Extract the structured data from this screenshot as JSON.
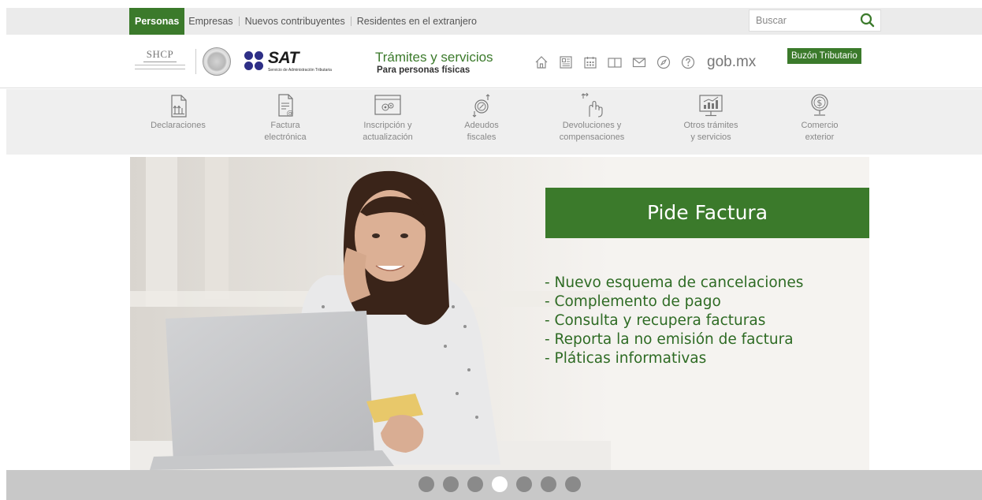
{
  "topbar": {
    "tabs": [
      {
        "label": "Personas",
        "active": true
      },
      {
        "label": "Empresas",
        "active": false
      },
      {
        "label": "Nuevos contribuyentes",
        "active": false
      },
      {
        "label": "Residentes en el extranjero",
        "active": false
      }
    ],
    "search": {
      "placeholder": "Buscar",
      "icon": "search-icon"
    }
  },
  "header": {
    "shcp_label": "SHCP",
    "sat_logo": "SAT",
    "sat_subtitle": "Servicio de Administración Tributaria",
    "tramites_title": "Trámites y servicios",
    "tramites_subtitle": "Para personas físicas",
    "nav_icons": [
      "home-icon",
      "news-icon",
      "calendar-icon",
      "book-icon",
      "mail-icon",
      "compass-icon",
      "help-icon"
    ],
    "gob_label": "gob.mx",
    "buzon_label": "Buzón Tributario"
  },
  "categories": [
    {
      "label": "Declaraciones",
      "icon": "declaraciones-icon"
    },
    {
      "label": "Factura\nelectrónica",
      "icon": "factura-icon"
    },
    {
      "label": "Inscripción y\nactualización",
      "icon": "inscripcion-icon"
    },
    {
      "label": "Adeudos\nfiscales",
      "icon": "adeudos-icon"
    },
    {
      "label": "Devoluciones y\ncompensaciones",
      "icon": "devoluciones-icon"
    },
    {
      "label": "Otros trámites\ny servicios",
      "icon": "otros-tramites-icon"
    },
    {
      "label": "Comercio\nexterior",
      "icon": "comercio-icon"
    }
  ],
  "hero": {
    "title": "Pide Factura",
    "bullets": [
      "- Nuevo esquema de cancelaciones",
      "- Complemento de pago",
      "- Consulta y recupera facturas",
      "- Reporta la no emisión de factura",
      "- Pláticas informativas"
    ]
  },
  "carousel": {
    "count": 7,
    "active_index": 3
  },
  "colors": {
    "brand_green": "#3b7a2b",
    "text_green": "#2e6b24",
    "topbar_bg": "#ebebeb",
    "sat_blue": "#2e2f86"
  }
}
